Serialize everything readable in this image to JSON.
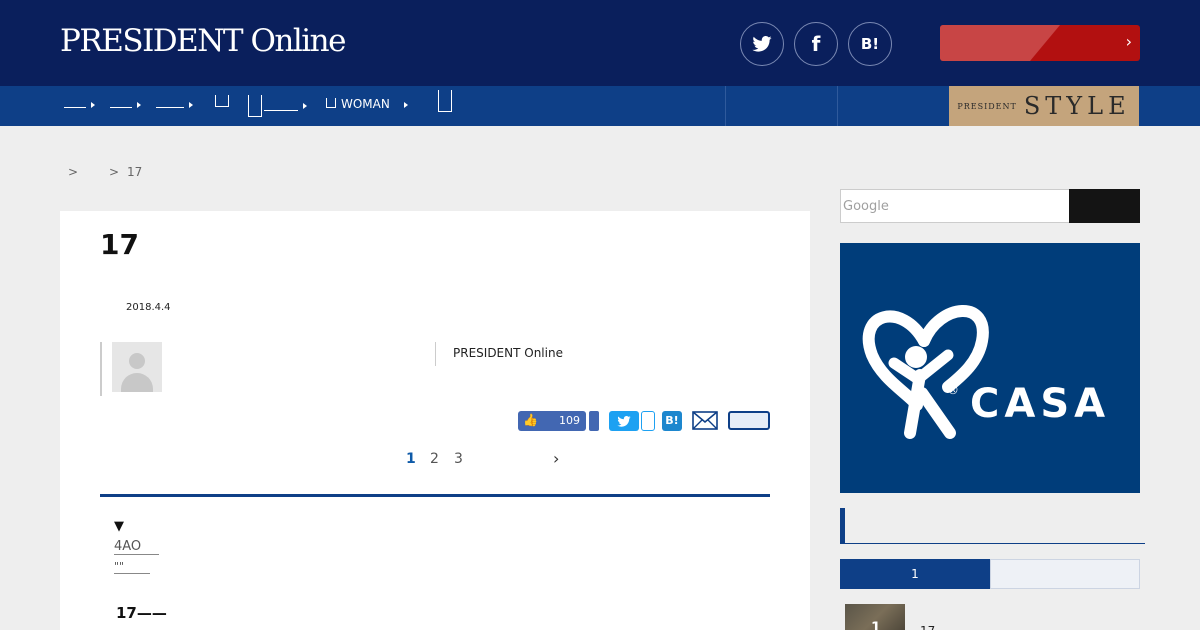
{
  "header": {
    "logo": "PRESIDENT Online",
    "social": [
      {
        "icon": "twitter-icon",
        "glyph": ""
      },
      {
        "icon": "facebook-icon",
        "glyph": "f"
      },
      {
        "icon": "hatena-icon",
        "glyph": "B!"
      }
    ],
    "cta_arrow": "›"
  },
  "nav": {
    "items": [
      "",
      "",
      "",
      "",
      "",
      "WOMAN",
      ""
    ],
    "style_banner": {
      "small": "PRESIDENT",
      "big": "STYLE"
    }
  },
  "breadcrumb": {
    "sep1": ">",
    "sep2": ">",
    "current": "17"
  },
  "article": {
    "title": "17",
    "date": "2018.4.4",
    "publisher": "PRESIDENT Online",
    "share": {
      "like_icon": "👍",
      "like_count": "109",
      "hatena_label": "B!"
    },
    "pagination": {
      "pages": [
        "1",
        "2",
        "3"
      ],
      "current": "1",
      "next": "›"
    },
    "toc_marker": "▼",
    "toc_links": [
      "4AO",
      "\"\""
    ],
    "subheading": "17——"
  },
  "sidebar": {
    "search": {
      "placeholder": "Google"
    },
    "ad": {
      "brand": "CASA",
      "reg": "®"
    },
    "ranking_tab_active": "1",
    "ranking_item": {
      "rank": "1",
      "title": "17"
    }
  },
  "colors": {
    "header_bg": "#0a1f5c",
    "nav_bg": "#0e3f87",
    "cta_red": "#b21010",
    "ad_blue": "#003d7a",
    "style_gold": "#c4a47c"
  }
}
